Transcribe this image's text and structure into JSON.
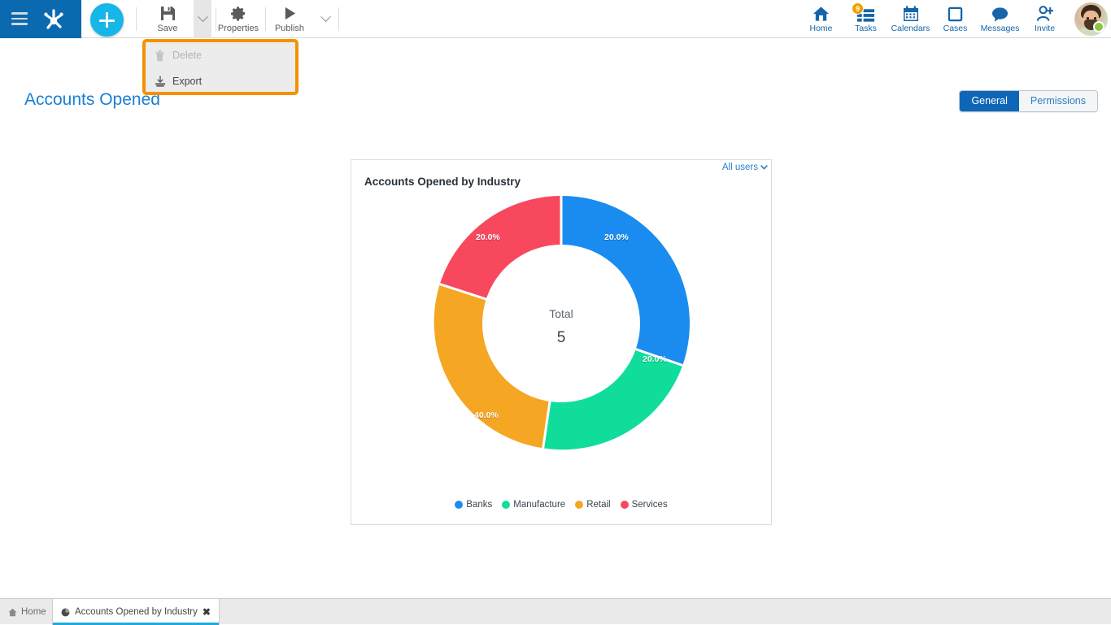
{
  "topbar": {
    "menu_icon": "hamburger-icon",
    "logo_icon": "app-logo-icon",
    "add_button_icon": "plus-icon",
    "tools": [
      {
        "id": "save",
        "label": "Save",
        "icon": "save-floppy-icon"
      },
      {
        "id": "properties",
        "label": "Properties",
        "icon": "gear-icon"
      },
      {
        "id": "publish",
        "label": "Publish",
        "icon": "play-triangle-icon"
      }
    ],
    "nav": [
      {
        "id": "home",
        "label": "Home",
        "icon": "home-icon",
        "badge": ""
      },
      {
        "id": "tasks",
        "label": "Tasks",
        "icon": "tasks-list-icon",
        "badge": "9"
      },
      {
        "id": "calendars",
        "label": "Calendars",
        "icon": "calendar-icon",
        "badge": ""
      },
      {
        "id": "cases",
        "label": "Cases",
        "icon": "square-icon",
        "badge": ""
      },
      {
        "id": "messages",
        "label": "Messages",
        "icon": "speech-bubble-icon",
        "badge": ""
      },
      {
        "id": "invite",
        "label": "Invite",
        "icon": "invite-person-plus-icon",
        "badge": ""
      }
    ],
    "avatar_icon": "user-avatar",
    "status": "online"
  },
  "subheader": {
    "page_title": "Accounts Opened",
    "tabs": [
      {
        "label": "General",
        "active": true
      },
      {
        "label": "Permissions",
        "active": false
      }
    ]
  },
  "dropdown_menu": {
    "highlighted": true,
    "highlight_color": "#f39200",
    "items": [
      {
        "label": "Delete",
        "icon": "trash-icon",
        "disabled": true
      },
      {
        "label": "Export",
        "icon": "export-icon",
        "disabled": false
      }
    ]
  },
  "card": {
    "title": "Accounts Opened by Industry",
    "users_filter": "All users",
    "users_filter_icon": "chevron-down-icon",
    "center_label": "Total",
    "center_value": "5"
  },
  "chart_data": {
    "type": "pie",
    "variant": "donut",
    "title": "Accounts Opened by Industry",
    "total": 5,
    "total_label": "Total",
    "legend_position": "bottom",
    "labels": [
      "Banks",
      "Manufacture",
      "Retail",
      "Services"
    ],
    "values": [
      1,
      1,
      2,
      1
    ],
    "percentages": [
      "20.0%",
      "20.0%",
      "40.0%",
      "20.0%"
    ],
    "colors": [
      "#1a8cf0",
      "#10dd9b",
      "#f5a623",
      "#f8485e"
    ],
    "slices": [
      {
        "label": "Banks",
        "value": 1,
        "percent": "20.0%",
        "color": "#1a8cf0",
        "start_deg": 0,
        "end_deg": 72
      },
      {
        "label": "Manufacture",
        "value": 1,
        "percent": "20.0%",
        "color": "#10dd9b",
        "start_deg": 72,
        "end_deg": 144
      },
      {
        "label": "Retail",
        "value": 2,
        "percent": "40.0%",
        "color": "#f5a623",
        "start_deg": 144,
        "end_deg": 288
      },
      {
        "label": "Services",
        "value": 1,
        "percent": "20.0%",
        "color": "#f8485e",
        "start_deg": 288,
        "end_deg": 360
      }
    ]
  },
  "taskbar": {
    "home_label": "Home",
    "home_icon": "home-small-icon",
    "tab_label": "Accounts Opened by Industry",
    "tab_icon": "pie-chart-icon",
    "tab_close_icon": "close-icon"
  }
}
